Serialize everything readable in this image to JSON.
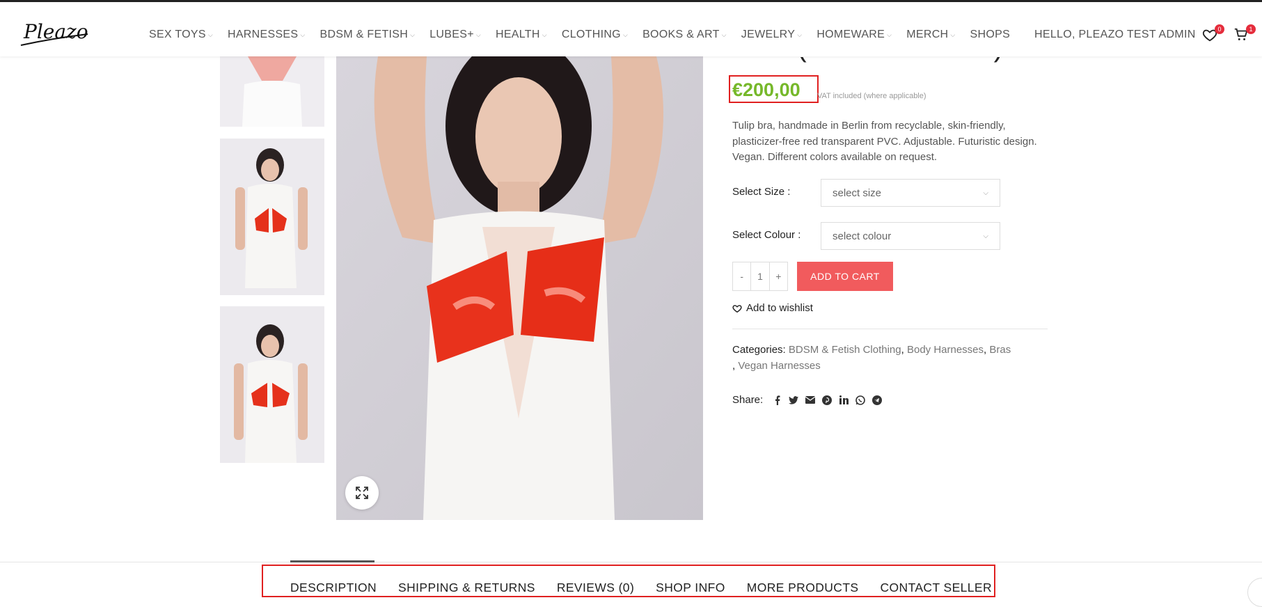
{
  "header": {
    "logo_text": "Pleazo",
    "nav": [
      {
        "label": "SEX TOYS",
        "has_dropdown": true
      },
      {
        "label": "HARNESSES",
        "has_dropdown": true
      },
      {
        "label": "BDSM & FETISH",
        "has_dropdown": true
      },
      {
        "label": "LUBES+",
        "has_dropdown": true
      },
      {
        "label": "HEALTH",
        "has_dropdown": true
      },
      {
        "label": "CLOTHING",
        "has_dropdown": true
      },
      {
        "label": "BOOKS & ART",
        "has_dropdown": true
      },
      {
        "label": "JEWELRY",
        "has_dropdown": true
      },
      {
        "label": "HOMEWARE",
        "has_dropdown": true
      },
      {
        "label": "MERCH",
        "has_dropdown": true
      },
      {
        "label": "SHOPS",
        "has_dropdown": false
      }
    ],
    "greeting": "HELLO, PLEAZO TEST ADMIN",
    "wishlist_count": "0",
    "cart_count": "1",
    "icons": {
      "wishlist": "heart-icon",
      "cart": "cart-icon"
    }
  },
  "product": {
    "title": "PVC (various colours)",
    "price": "€200,00",
    "vat_note": "VAT included (where applicable)",
    "description": "Tulip bra, handmade in Berlin from recyclable, skin-friendly, plasticizer-free red transparent PVC. Adjustable. Futuristic design. Vegan. Different colors available on request.",
    "size_label": "Select Size :",
    "size_placeholder": "select size",
    "colour_label": "Select Colour :",
    "colour_placeholder": "select colour",
    "qty_minus": "-",
    "qty_value": "1",
    "qty_plus": "+",
    "add_to_cart": "ADD TO CART",
    "wishlist": "Add to wishlist",
    "categories_label": "Categories:",
    "categories": [
      "BDSM & Fetish Clothing",
      "Body Harnesses",
      "Bras",
      "Vegan Harnesses"
    ],
    "share_label": "Share:",
    "share_icons": [
      "facebook-icon",
      "twitter-icon",
      "email-icon",
      "pinterest-icon",
      "linkedin-icon",
      "whatsapp-icon",
      "telegram-icon"
    ]
  },
  "tabs": [
    "DESCRIPTION",
    "SHIPPING & RETURNS",
    "REVIEWS (0)",
    "SHOP INFO",
    "MORE PRODUCTS",
    "CONTACT SELLER"
  ],
  "colors": {
    "price": "#76b82a",
    "button": "#f15b5d",
    "highlight": "#e02020",
    "badge": "#e52d3c"
  }
}
